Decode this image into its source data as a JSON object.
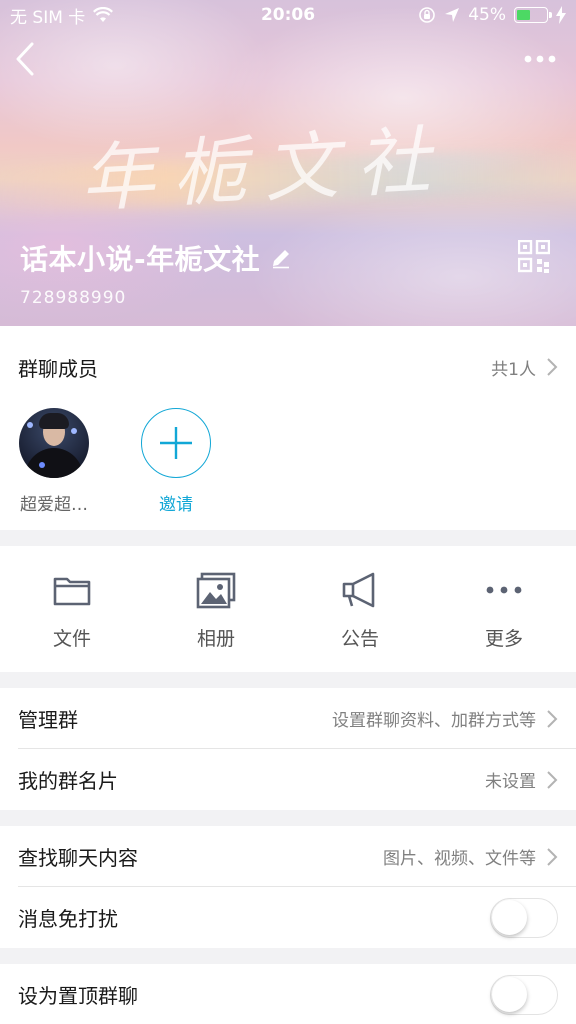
{
  "status_bar": {
    "carrier": "无 SIM 卡",
    "time": "20:06",
    "battery_percent": "45%",
    "battery_level": 0.45,
    "battery_color": "#4cd964"
  },
  "header": {
    "back_icon": "chevron-left-icon",
    "more_icon": "ellipsis-icon",
    "banner_text": "年栀文社",
    "group_name": "话本小说-年栀文社",
    "group_id": "728988990",
    "qr_icon": "qr-code-icon",
    "edit_icon": "pencil-icon"
  },
  "members": {
    "title": "群聊成员",
    "count_text": "共1人",
    "list": [
      {
        "name": "超爱超…"
      }
    ],
    "invite_label": "邀请",
    "accent_color": "#12a7d6"
  },
  "quick_actions": [
    {
      "label": "文件",
      "icon": "folder-icon"
    },
    {
      "label": "相册",
      "icon": "photo-album-icon"
    },
    {
      "label": "公告",
      "icon": "megaphone-icon"
    },
    {
      "label": "更多",
      "icon": "more-dots-icon"
    }
  ],
  "manage": {
    "manage_group": {
      "label": "管理群",
      "value": "设置群聊资料、加群方式等"
    },
    "my_card": {
      "label": "我的群名片",
      "value": "未设置"
    }
  },
  "search_section": {
    "find_chat": {
      "label": "查找聊天内容",
      "value": "图片、视频、文件等"
    },
    "mute": {
      "label": "消息免打扰",
      "enabled": false
    }
  },
  "pin_section": {
    "pin": {
      "label": "设为置顶群聊",
      "enabled": false
    }
  }
}
